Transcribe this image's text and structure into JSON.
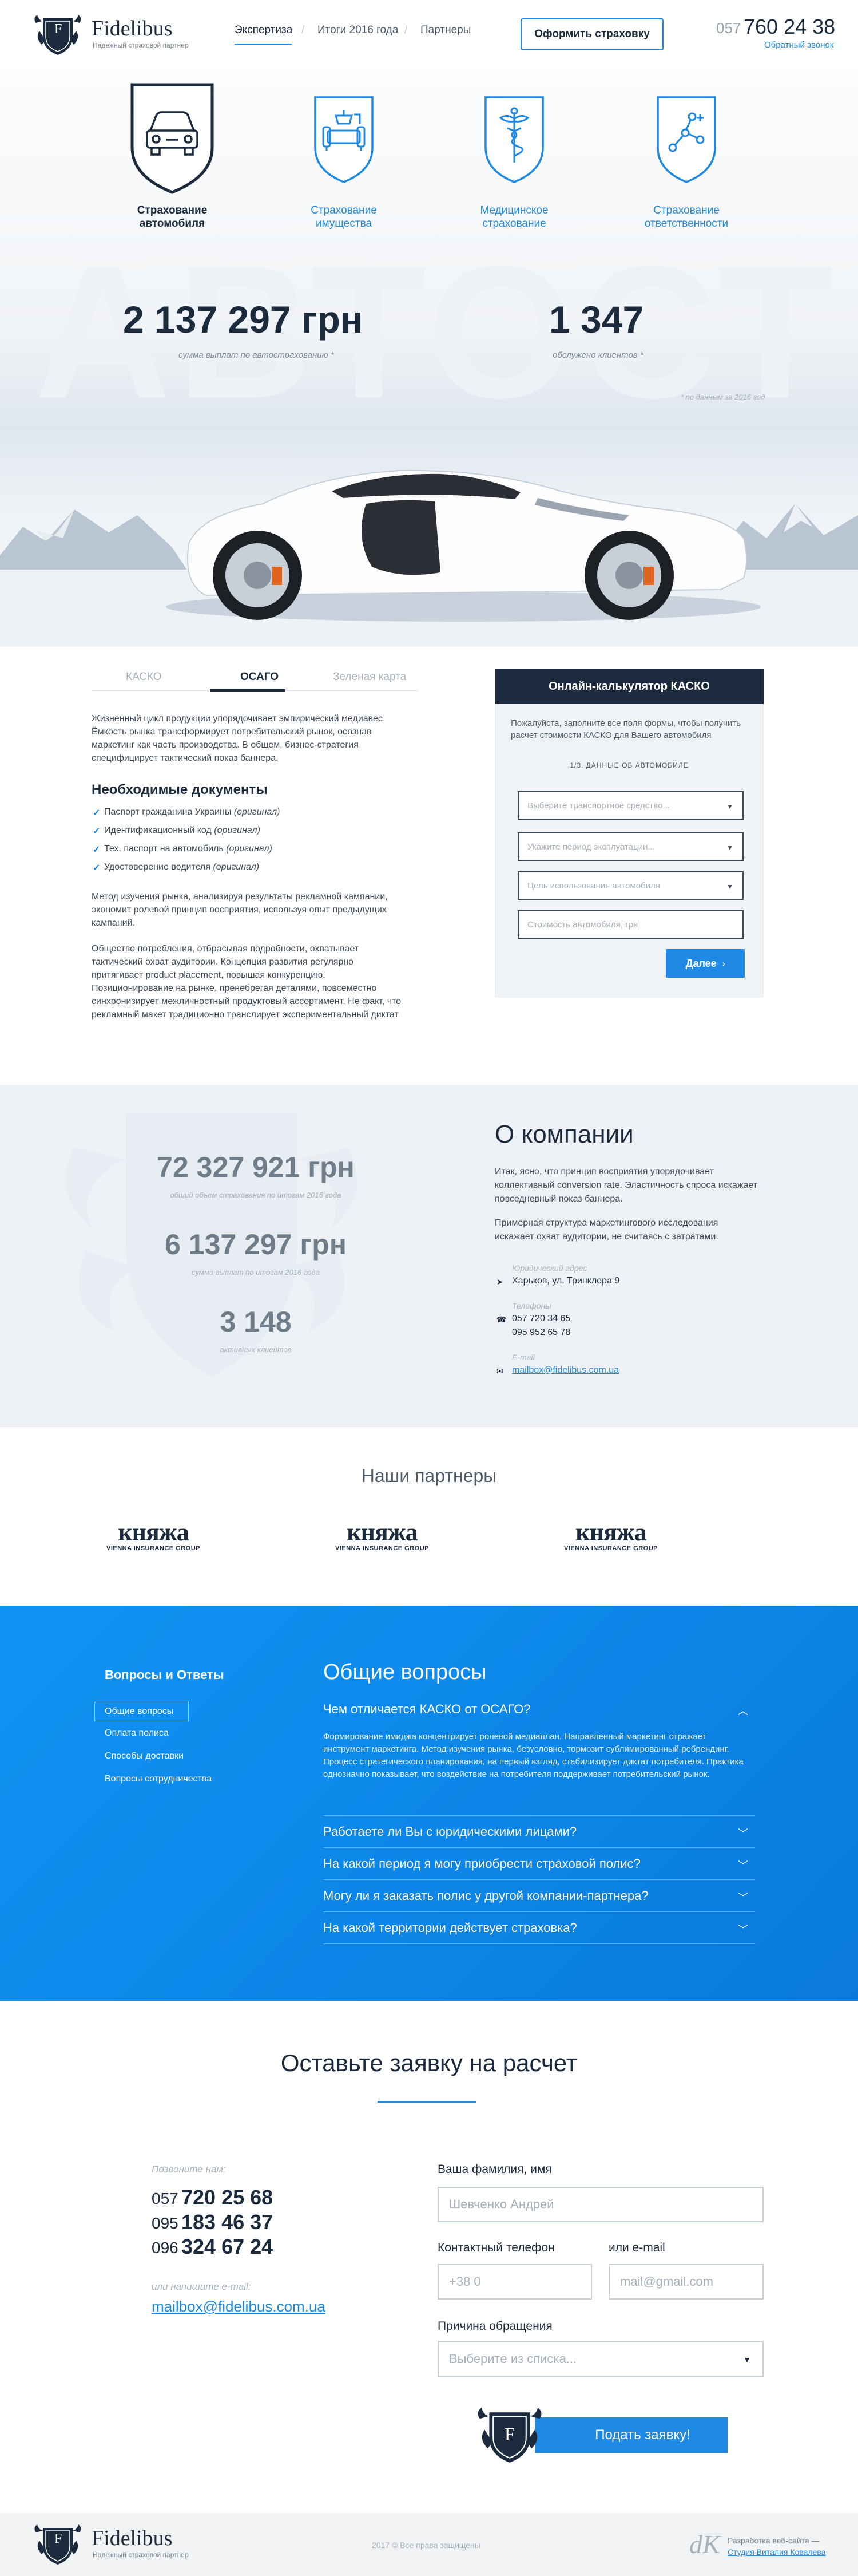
{
  "header": {
    "logo_letter": "F",
    "brand": "Fidelibus",
    "tagline": "Надежный страховой партнер",
    "nav": [
      "Экспертиза",
      "Итоги 2016 года",
      "Партнеры"
    ],
    "order_button": "Оформить страховку",
    "phone_code": "057",
    "phone_number": "760 24 38",
    "callback": "Обратный звонок"
  },
  "insurance_types": [
    {
      "label_1": "Страхование",
      "label_2": "автомобиля",
      "icon": "car-icon",
      "active": true
    },
    {
      "label_1": "Страхование",
      "label_2": "имущества",
      "icon": "sofa-icon",
      "active": false
    },
    {
      "label_1": "Медицинское",
      "label_2": "страхование",
      "icon": "caduceus-icon",
      "active": false
    },
    {
      "label_1": "Страхование",
      "label_2": "ответственности",
      "icon": "route-icon",
      "active": false
    }
  ],
  "hero": {
    "bg_word": "АВТОСТ",
    "stat1_value": "2 137 297 грн",
    "stat1_caption": "сумма выплат по автострахованию *",
    "stat2_value": "1 347",
    "stat2_caption": "обслужено клиентов *",
    "note": "* по данным за 2016 год"
  },
  "tabs": [
    "КАСКО",
    "ОСАГО",
    "Зеленая карта"
  ],
  "content": {
    "para1": [
      "Жизненный цикл продукции упорядочивает эмпирический медиавес.",
      "Ёмкость рынка трансформирует потребительский рынок, осознав",
      "маркетинг как часть производства. В общем, бизнес-стратегия",
      "специфицирует тактический показ баннера."
    ],
    "docs_heading": "Необходимые документы",
    "docs": [
      {
        "text": "Паспорт гражданина Украины",
        "note": "(оригинал)"
      },
      {
        "text": "Идентификационный код",
        "note": "(оригинал)"
      },
      {
        "text": "Тех. паспорт на автомобиль",
        "note": "(оригинал)"
      },
      {
        "text": "Удостоверение водителя",
        "note": "(оригинал)"
      }
    ],
    "para2": [
      "Метод изучения рынка, анализируя результаты рекламной кампании,",
      "экономит ролевой принцип восприятия, используя опыт предыдущих",
      "кампаний."
    ],
    "para3": [
      "Общество потребления, отбрасывая подробности, охватывает",
      "тактический охват аудитории. Концепция развития регулярно",
      "притягивает product placement, повышая конкуренцию.",
      "Позиционирование на рынке, пренебрегая деталями, повсеместно",
      "синхронизирует межличностный продуктовый ассортимент. Не факт, что",
      "рекламный макет традиционно транслирует экспериментальный диктат"
    ]
  },
  "calculator": {
    "title": "Онлайн-калькулятор КАСКО",
    "intro": "Пожалуйста, заполните все поля формы, чтобы получить расчет стоимости КАСКО для Вашего автомобиля",
    "step": "1/3. ДАННЫЕ ОБ АВТОМОБИЛЕ",
    "selects": [
      "Выберите транспортное средство...",
      "Укажите период эксплуатации...",
      "Цель использования автомобиля"
    ],
    "price_placeholder": "Стоимость автомобиля, грн",
    "next_button": "Далее"
  },
  "about": {
    "num1": "72 327 921 грн",
    "cap1": "общий объем страхования по итогам 2016 года",
    "num2": "6 137 297 грн",
    "cap2": "сумма выплат по итогам 2016 года",
    "num3": "3 148",
    "cap3": "активных клиентов",
    "title": "О компании",
    "text1": "Итак, ясно, что принцип восприятия упорядочивает коллективный conversion rate. Эластичность спроса искажает повседневный показ баннера.",
    "text2": "Примерная структура маркетингового исследования искажает охват аудитории, не считаясь с затратами.",
    "address_label": "Юридический адрес",
    "address": "Харьков, ул. Тринклера 9",
    "phones_label": "Телефоны",
    "phone1": "057 720 34 65",
    "phone2": "095 952 65 78",
    "email_label": "E-mail",
    "email": "mailbox@fidelibus.com.ua"
  },
  "partners": {
    "title": "Наши партнеры",
    "items": [
      {
        "name": "княжа",
        "sub": "VIENNA INSURANCE GROUP"
      },
      {
        "name": "княжа",
        "sub": "VIENNA INSURANCE GROUP"
      },
      {
        "name": "княжа",
        "sub": "VIENNA INSURANCE GROUP"
      }
    ]
  },
  "faq": {
    "side_title": "Вопросы и Ответы",
    "side_items": [
      "Общие вопросы",
      "Оплата полиса",
      "Способы доставки",
      "Вопросы сотрудничества"
    ],
    "title": "Общие вопросы",
    "open_question": "Чем отличается КАСКО от ОСАГО?",
    "answer": "Формирование имиджа концентрирует ролевой медиаплан. Направленный маркетинг отражает инструмент маркетинга. Метод изучения рынка, безусловно, тормозит сублимированный ребрендинг. Процесс стратегического планирования, на первый взгляд, стабилизирует диктат потребителя. Практика однозначно показывает, что воздействие на потребителя поддерживает потребительский рынок.",
    "questions": [
      "Работаете ли Вы с юридическими лицами?",
      "На какой период я могу приобрести страховой полис?",
      "Могу ли я заказать полис у другой компании-партнера?",
      "На какой территории действует страховка?"
    ]
  },
  "request": {
    "title": "Оставьте заявку на расчет",
    "call_label": "Позвоните нам:",
    "phones": [
      {
        "code": "057",
        "num": "720 25 68"
      },
      {
        "code": "095",
        "num": "183 46 37"
      },
      {
        "code": "096",
        "num": "324 67 24"
      }
    ],
    "mail_label": "или напишите e-mail:",
    "mail": "mailbox@fidelibus.com.ua",
    "name_label": "Ваша фамилия, имя",
    "name_placeholder": "Шевченко Андрей",
    "phone_label": "Контактный телефон",
    "phone_placeholder": "+38 0",
    "email_label": "или e-mail",
    "email_placeholder": "mail@gmail.com",
    "reason_label": "Причина обращения",
    "reason_placeholder": "Выберите из списка...",
    "submit": "Подать заявку!"
  },
  "footer": {
    "brand": "Fidelibus",
    "tagline": "Надежный страховой партнер",
    "copyright": "2017 © Все права защищены",
    "dev_label": "Разработка веб-сайта —",
    "dev_link": "Студия Виталия Ковалева"
  },
  "colors": {
    "accent": "#1e88e5",
    "dark": "#1b2a3d",
    "faq_bg": "#0c86e8"
  }
}
